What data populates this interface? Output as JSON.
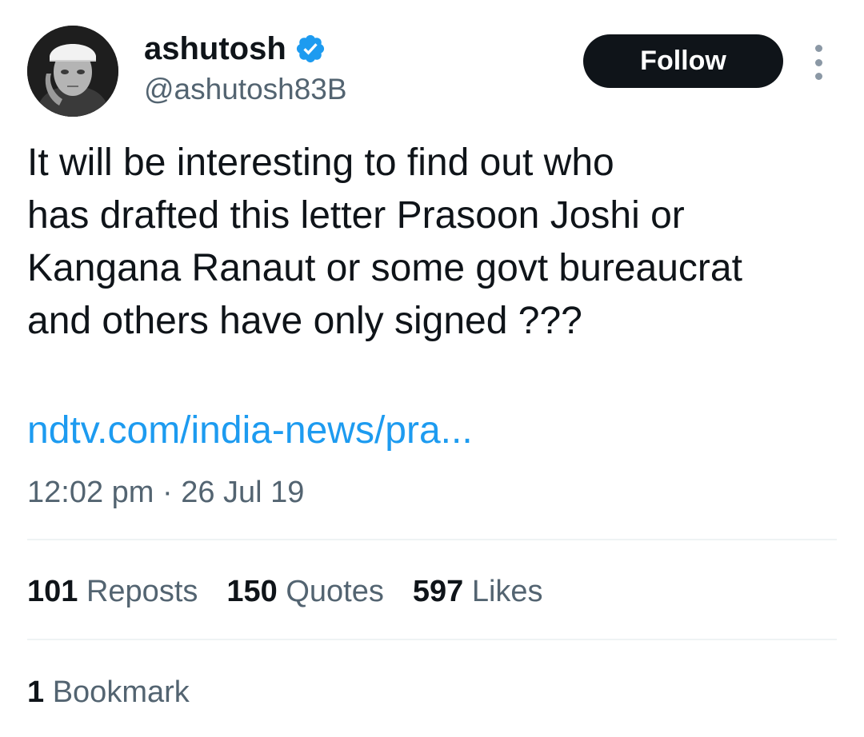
{
  "author": {
    "display_name": "ashutosh",
    "handle": "@ashutosh83B",
    "verified": true,
    "avatar_icon": "profile-photo"
  },
  "actions": {
    "follow_label": "Follow",
    "more_icon": "more-options-icon"
  },
  "tweet": {
    "text_lines": [
      "It will be interesting to find out who",
      "has drafted this letter Prasoon Joshi or",
      "Kangana Ranaut or some govt bureaucrat",
      "and others have only signed ???"
    ],
    "link": "ndtv.com/india-news/pra...",
    "timestamp": "12:02 pm · 26 Jul 19"
  },
  "stats": {
    "reposts": {
      "count": "101",
      "label": "Reposts"
    },
    "quotes": {
      "count": "150",
      "label": "Quotes"
    },
    "likes": {
      "count": "597",
      "label": "Likes"
    }
  },
  "bookmarks": {
    "count": "1",
    "label": "Bookmark"
  },
  "colors": {
    "text": "#0f1419",
    "secondary": "#536471",
    "link": "#1d9bf0",
    "verified": "#1d9bf0",
    "button_bg": "#0f1419",
    "divider": "#eff3f4"
  }
}
